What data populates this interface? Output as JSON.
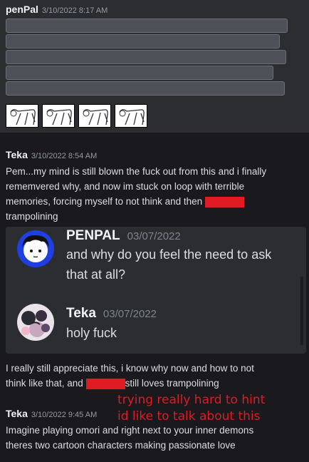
{
  "message_1": {
    "author": "penPal",
    "timestamp": "3/10/2022 8:17 AM",
    "redacted_lines": 5,
    "attachments": [
      "image-1",
      "image-2",
      "image-3",
      "image-4"
    ]
  },
  "message_2": {
    "author": "Teka",
    "timestamp": "3/10/2022 8:54 AM",
    "line1": "Pem...my mind is still blown the fuck out from this and i finally",
    "line2": "rememvered why, and now im stuck on loop with terrible",
    "line3": "memories, forcing myself to not think and then",
    "line4": "trampolining"
  },
  "embed": {
    "quote1": {
      "author": "PENPAL",
      "timestamp": "03/07/2022",
      "line1": "and why do you feel the need to ask",
      "line2": "that at all?"
    },
    "quote2": {
      "author": "Teka",
      "timestamp": "03/07/2022",
      "line1": "holy fuck"
    }
  },
  "message_3": {
    "line1": "I really still appreciate this, i know why now and how to not",
    "line2a": "think like that, and",
    "line2b": "still loves trampolining"
  },
  "annotation": {
    "line1": "trying really hard to hint",
    "line2": "id like to talk about this"
  },
  "message_4": {
    "author": "Teka",
    "timestamp": "3/10/2022 9:45 AM",
    "line1": "Imagine playing omori and right next to your inner demons",
    "line2": "theres two cartoon characters making passionate love"
  },
  "colors": {
    "redaction": "#e01b24",
    "background": "#1a1a1e",
    "annotation": "#e01b24"
  }
}
